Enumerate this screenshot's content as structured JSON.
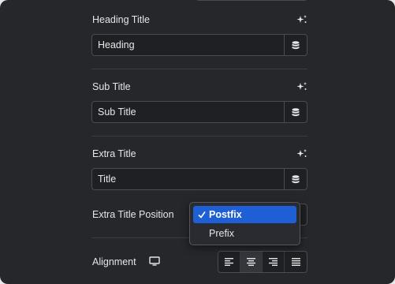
{
  "fields": {
    "heading": {
      "label": "Heading Title",
      "value": "Heading"
    },
    "subtitle": {
      "label": "Sub Title",
      "value": "Sub Title"
    },
    "extra": {
      "label": "Extra Title",
      "value": "Title"
    }
  },
  "extra_position": {
    "label": "Extra Title Position",
    "options": [
      "Postfix",
      "Prefix"
    ],
    "selected": "Postfix"
  },
  "alignment": {
    "label": "Alignment",
    "options": [
      "align-left",
      "align-center",
      "align-right",
      "align-justify"
    ],
    "active": "align-center"
  },
  "icons": {
    "ai": "sparkles-icon",
    "dynamic": "database-icon",
    "device": "desktop-icon",
    "check": "checkmark-icon"
  },
  "colors": {
    "panel": "#26272b",
    "selected_option": "#1f5fd6",
    "text": "#e6e6e8"
  }
}
